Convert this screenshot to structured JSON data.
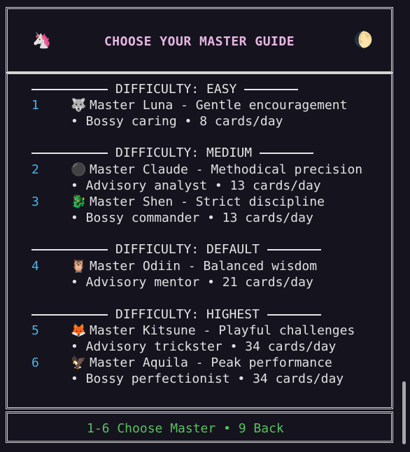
{
  "header": {
    "title": "CHOOSE YOUR MASTER GUIDE",
    "left_icon": "🦄",
    "right_icon": "🌔"
  },
  "sections": [
    {
      "heading": "DIFFICULTY: EASY",
      "masters": [
        {
          "number": "1",
          "emoji": "🐺",
          "title": "Master Luna - Gentle encouragement",
          "detail": "• Bossy caring • 8 cards/day"
        }
      ]
    },
    {
      "heading": "DIFFICULTY: MEDIUM",
      "masters": [
        {
          "number": "2",
          "emoji": "⚫",
          "title": "Master Claude - Methodical precision",
          "detail": "• Advisory analyst • 13 cards/day"
        },
        {
          "number": "3",
          "emoji": "🐉",
          "title": "Master Shen - Strict discipline",
          "detail": "• Bossy commander • 13 cards/day"
        }
      ]
    },
    {
      "heading": "DIFFICULTY: DEFAULT",
      "masters": [
        {
          "number": "4",
          "emoji": "🦉",
          "title": "Master Odiin - Balanced wisdom",
          "detail": "• Advisory mentor • 21 cards/day"
        }
      ]
    },
    {
      "heading": "DIFFICULTY: HIGHEST",
      "masters": [
        {
          "number": "5",
          "emoji": "🦊",
          "title": "Master Kitsune - Playful challenges",
          "detail": "• Advisory trickster • 34 cards/day"
        },
        {
          "number": "6",
          "emoji": "🦅",
          "title": "Master Aquila - Peak performance",
          "detail": "• Bossy perfectionist • 34 cards/day"
        }
      ]
    }
  ],
  "footer": {
    "text": "1-6 Choose Master • 9 Back"
  },
  "colors": {
    "background": "#15131e",
    "title": "#e8b6e3",
    "number": "#4bb4e6",
    "footer": "#59c25f",
    "text": "#e0e0e0"
  }
}
